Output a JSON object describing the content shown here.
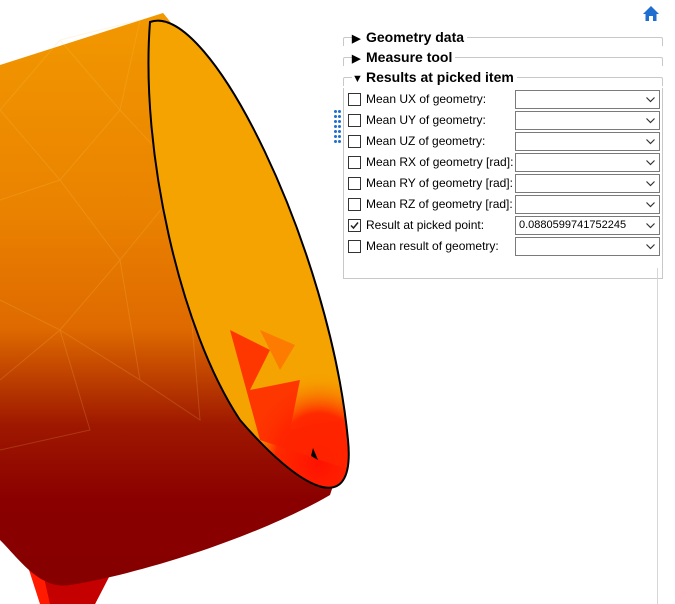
{
  "panel": {
    "sections": [
      {
        "label": "Geometry data",
        "expanded": false
      },
      {
        "label": "Measure tool",
        "expanded": false
      },
      {
        "label": "Results at picked item",
        "expanded": true
      }
    ],
    "rows": [
      {
        "label": "Mean UX of geometry:",
        "checked": false,
        "value": ""
      },
      {
        "label": "Mean UY of geometry:",
        "checked": false,
        "value": ""
      },
      {
        "label": "Mean UZ of geometry:",
        "checked": false,
        "value": ""
      },
      {
        "label": "Mean RX of geometry [rad]:",
        "checked": false,
        "value": ""
      },
      {
        "label": "Mean RY of geometry [rad]:",
        "checked": false,
        "value": ""
      },
      {
        "label": "Mean RZ of geometry [rad]:",
        "checked": false,
        "value": ""
      },
      {
        "label": "Result at picked point:",
        "checked": true,
        "value": "0.0880599741752245"
      },
      {
        "label": "Mean result of geometry:",
        "checked": false,
        "value": ""
      }
    ]
  },
  "icons": {
    "home": "home-icon",
    "expanded_arrow": "triangle-down-icon",
    "collapsed_arrow": "triangle-right-icon",
    "dropdown": "chevron-down-icon",
    "check": "checkmark-icon"
  },
  "colors": {
    "accent": "#1e6fd0",
    "model_orange": "#f5a300",
    "model_dark_red": "#8a0000",
    "model_red": "#ff1a00"
  }
}
